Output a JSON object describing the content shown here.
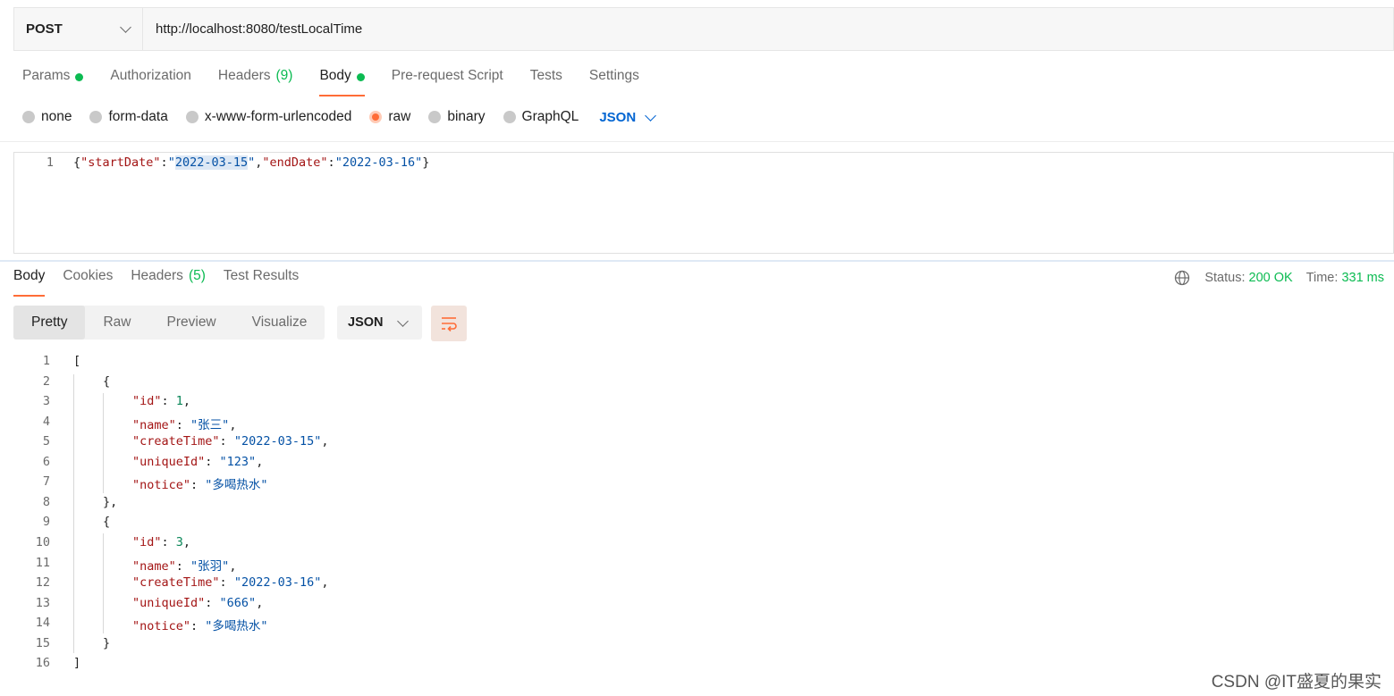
{
  "request": {
    "method": "POST",
    "url": "http://localhost:8080/testLocalTime",
    "tabs": [
      {
        "label": "Params",
        "dot": true,
        "count": ""
      },
      {
        "label": "Authorization",
        "dot": false,
        "count": ""
      },
      {
        "label": "Headers",
        "dot": false,
        "count": "(9)"
      },
      {
        "label": "Body",
        "dot": true,
        "count": "",
        "active": true
      },
      {
        "label": "Pre-request Script",
        "dot": false,
        "count": ""
      },
      {
        "label": "Tests",
        "dot": false,
        "count": ""
      },
      {
        "label": "Settings",
        "dot": false,
        "count": ""
      }
    ],
    "body_types": [
      "none",
      "form-data",
      "x-www-form-urlencoded",
      "raw",
      "binary",
      "GraphQL"
    ],
    "selected_body_type": "raw",
    "language": "JSON",
    "editor_line_number": "1",
    "editor_content": {
      "open": "{",
      "k1": "\"startDate\"",
      "colon": ":",
      "q": "\"",
      "v1_selected": "2022-03-15",
      "comma": ",",
      "k2": "\"endDate\"",
      "v2": "\"2022-03-16\"",
      "close": "}"
    }
  },
  "response": {
    "tabs": [
      {
        "label": "Body",
        "count": "",
        "active": true
      },
      {
        "label": "Cookies",
        "count": ""
      },
      {
        "label": "Headers",
        "count": "(5)"
      },
      {
        "label": "Test Results",
        "count": ""
      }
    ],
    "status_label": "Status:",
    "status_value": "200 OK",
    "time_label": "Time:",
    "time_value": "331 ms",
    "view_modes": [
      "Pretty",
      "Raw",
      "Preview",
      "Visualize"
    ],
    "active_view": "Pretty",
    "format": "JSON",
    "body_lines": [
      {
        "num": "1",
        "indent": 0,
        "punct": "["
      },
      {
        "num": "2",
        "indent": 1,
        "punct": "{"
      },
      {
        "num": "3",
        "indent": 2,
        "key": "\"id\"",
        "value": "1",
        "type": "num",
        "comma": true
      },
      {
        "num": "4",
        "indent": 2,
        "key": "\"name\"",
        "value": "\"张三\"",
        "type": "str",
        "comma": true
      },
      {
        "num": "5",
        "indent": 2,
        "key": "\"createTime\"",
        "value": "\"2022-03-15\"",
        "type": "str",
        "comma": true
      },
      {
        "num": "6",
        "indent": 2,
        "key": "\"uniqueId\"",
        "value": "\"123\"",
        "type": "str",
        "comma": true
      },
      {
        "num": "7",
        "indent": 2,
        "key": "\"notice\"",
        "value": "\"多喝热水\"",
        "type": "str",
        "comma": false
      },
      {
        "num": "8",
        "indent": 1,
        "punct": "},"
      },
      {
        "num": "9",
        "indent": 1,
        "punct": "{"
      },
      {
        "num": "10",
        "indent": 2,
        "key": "\"id\"",
        "value": "3",
        "type": "num",
        "comma": true
      },
      {
        "num": "11",
        "indent": 2,
        "key": "\"name\"",
        "value": "\"张羽\"",
        "type": "str",
        "comma": true
      },
      {
        "num": "12",
        "indent": 2,
        "key": "\"createTime\"",
        "value": "\"2022-03-16\"",
        "type": "str",
        "comma": true
      },
      {
        "num": "13",
        "indent": 2,
        "key": "\"uniqueId\"",
        "value": "\"666\"",
        "type": "str",
        "comma": true
      },
      {
        "num": "14",
        "indent": 2,
        "key": "\"notice\"",
        "value": "\"多喝热水\"",
        "type": "str",
        "comma": false
      },
      {
        "num": "15",
        "indent": 1,
        "punct": "}"
      },
      {
        "num": "16",
        "indent": 0,
        "punct": "]"
      }
    ]
  },
  "watermark": "CSDN @IT盛夏的果实",
  "colors": {
    "accent": "#ff6c37",
    "success": "#0cbb52",
    "link": "#0265d2"
  }
}
